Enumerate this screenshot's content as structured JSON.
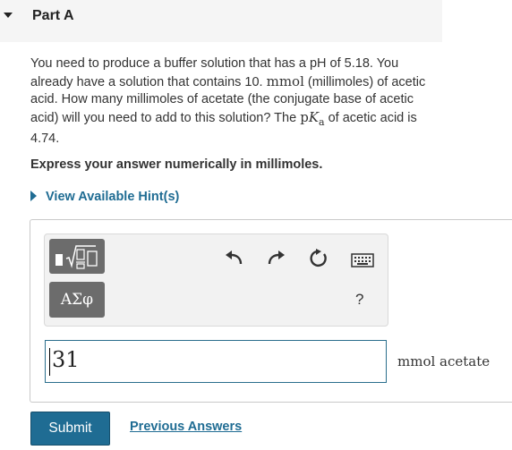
{
  "part": {
    "title": "Part A"
  },
  "question": {
    "s1": "You need to produce a buffer solution that has a pH of 5.18. You already have a solution that contains 10. ",
    "unit_mmol": "mmol",
    "s2": " (millimoles) of acetic acid. How many millimoles of acetate (the conjugate base of acetic acid) will you need to add to this solution? The ",
    "pka_p": "p",
    "pka_k": "K",
    "pka_sub": "a",
    "s3": " of acetic acid is 4.74."
  },
  "instruction": "Express your answer numerically in millimoles.",
  "hint": {
    "label": "View Available Hint(s)"
  },
  "toolbar": {
    "greek_label": "ΑΣφ",
    "help_label": "?",
    "icons": [
      "templates-icon",
      "greek-letters-icon",
      "undo-icon",
      "redo-icon",
      "reset-icon",
      "keyboard-icon",
      "help-icon"
    ]
  },
  "answer": {
    "value": "31",
    "units": "mmol acetate"
  },
  "actions": {
    "submit_label": "Submit",
    "previous_label": "Previous Answers"
  }
}
